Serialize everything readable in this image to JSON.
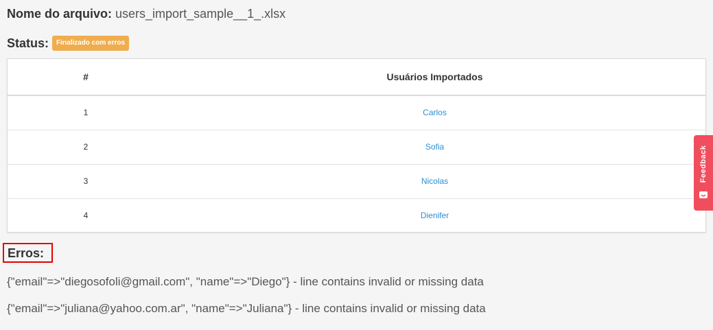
{
  "file": {
    "label": "Nome do arquivo:",
    "name": "users_import_sample__1_.xlsx"
  },
  "status": {
    "label": "Status:",
    "badge": "Finalizado com erros",
    "badge_color": "#f0ad4e"
  },
  "table": {
    "headers": [
      "#",
      "Usuários Importados"
    ],
    "rows": [
      {
        "num": "1",
        "name": "Carlos"
      },
      {
        "num": "2",
        "name": "Sofia"
      },
      {
        "num": "3",
        "name": "Nicolas"
      },
      {
        "num": "4",
        "name": "Dienifer"
      }
    ]
  },
  "errors": {
    "title": "Erros:",
    "lines": [
      "{\"email\"=>\"diegosofoli@gmail.com\", \"name\"=>\"Diego\"} - line contains invalid or missing data",
      "{\"email\"=>\"juliana@yahoo.com.ar\", \"name\"=>\"Juliana\"} - line contains invalid or missing data"
    ]
  },
  "feedback": {
    "label": "Feedback",
    "icon": "smile-icon",
    "color": "#f04e5e"
  },
  "colors": {
    "link": "#2a8fd4",
    "highlight_border": "#e30000"
  }
}
